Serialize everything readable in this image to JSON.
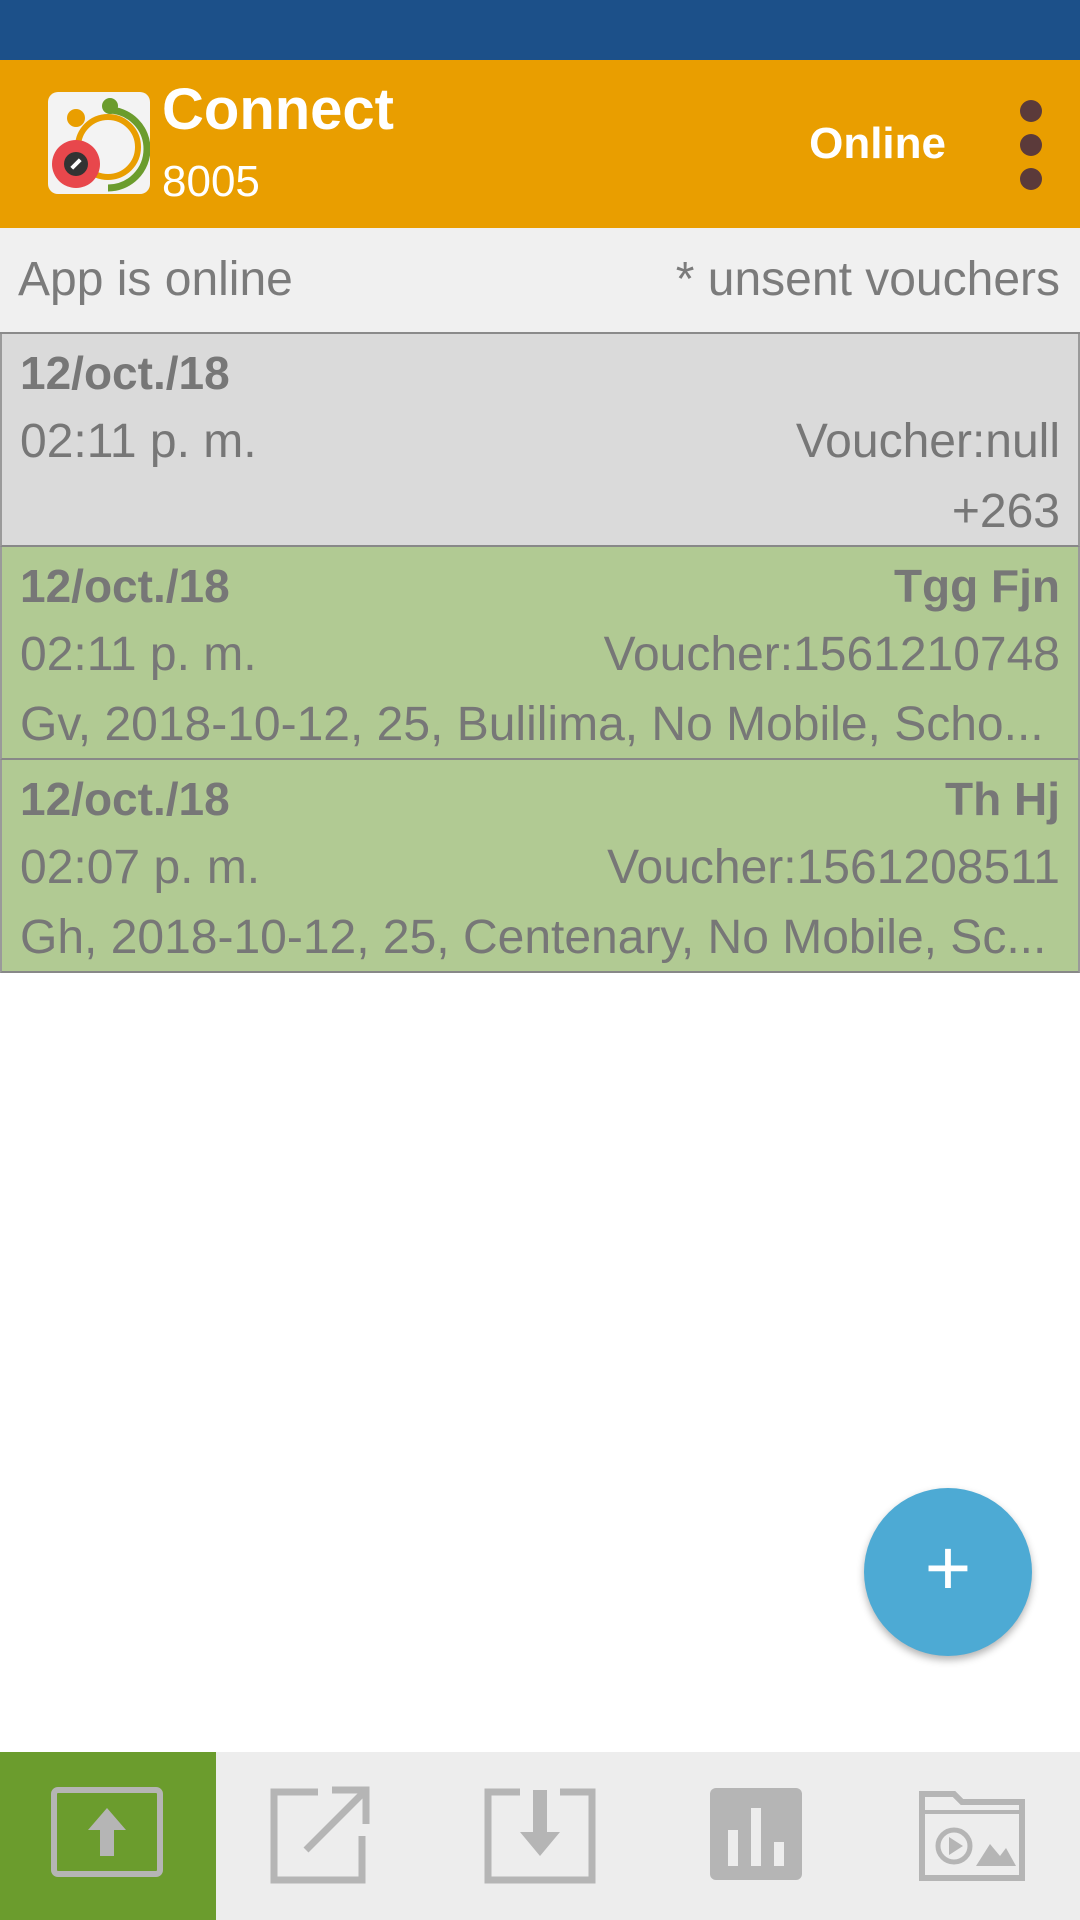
{
  "header": {
    "title": "Connect",
    "subtitle": "8005",
    "status": "Online",
    "logo_icon": "app-logo-icon",
    "menu_icon": "overflow-menu-icon"
  },
  "info_bar": {
    "left_text": "App is online",
    "right_text": "* unsent vouchers"
  },
  "vouchers": [
    {
      "state": "pending",
      "date": "12/oct./18",
      "name": "",
      "time": "02:11 p. m.",
      "voucher": "Voucher:null",
      "details": "+263"
    },
    {
      "state": "sent",
      "date": "12/oct./18",
      "name": "Tgg Fjn",
      "time": "02:11 p. m.",
      "voucher": "Voucher:1561210748",
      "details": "Gv, 2018-10-12, 25, Bulilima, No Mobile, Scho..."
    },
    {
      "state": "sent",
      "date": "12/oct./18",
      "name": "Th Hj",
      "time": "02:07 p. m.",
      "voucher": "Voucher:1561208511",
      "details": "Gh, 2018-10-12, 25, Centenary, No Mobile, Sc..."
    }
  ],
  "fab": {
    "label": "+",
    "icon": "add-icon"
  },
  "bottom_nav": [
    {
      "icon": "upload-icon",
      "active": true
    },
    {
      "icon": "open-external-icon",
      "active": false
    },
    {
      "icon": "download-icon",
      "active": false
    },
    {
      "icon": "bar-chart-icon",
      "active": false
    },
    {
      "icon": "media-folder-icon",
      "active": false
    }
  ],
  "colors": {
    "status_bar": "#1c5089",
    "app_bar": "#e99e00",
    "pending_row": "#dadada",
    "sent_row": "#b1ca93",
    "fab": "#4daad4",
    "nav_active": "#6b9c2d",
    "nav_icon": "#b5b5b5"
  }
}
